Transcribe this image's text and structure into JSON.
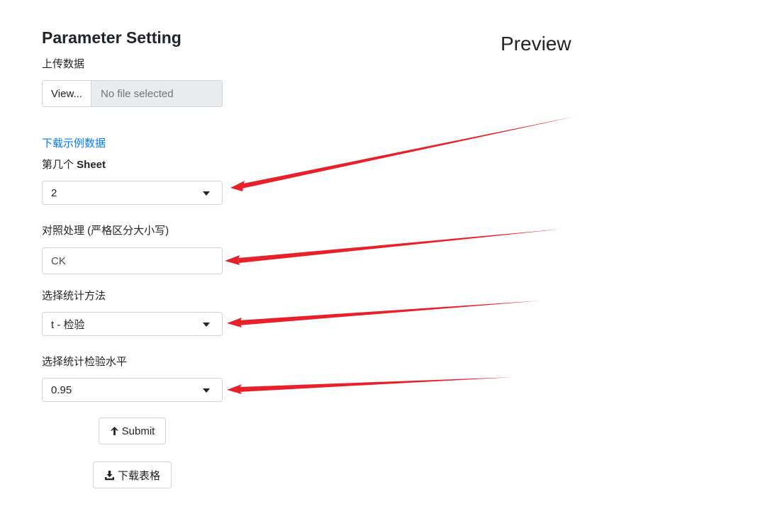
{
  "sidebar": {
    "title": "Parameter Setting",
    "upload": {
      "label": "上传数据",
      "button_label": "View...",
      "placeholder": "No file selected"
    },
    "download_example_link": "下载示例数据",
    "sheet": {
      "label_prefix": "第几个 ",
      "label_bold": "Sheet",
      "value": "2"
    },
    "control": {
      "label": "对照处理 (严格区分大小写)",
      "value": "CK"
    },
    "method": {
      "label": "选择统计方法",
      "value": "t - 检验"
    },
    "level": {
      "label": "选择统计检验水平",
      "value": "0.95"
    },
    "submit_label": "Submit",
    "download_table_label": "下载表格"
  },
  "main": {
    "title": "Preview"
  },
  "colors": {
    "arrow": "#e8202a",
    "link": "#007bff"
  },
  "icons": [
    "caret-down-icon",
    "arrow-up-icon",
    "download-icon"
  ]
}
